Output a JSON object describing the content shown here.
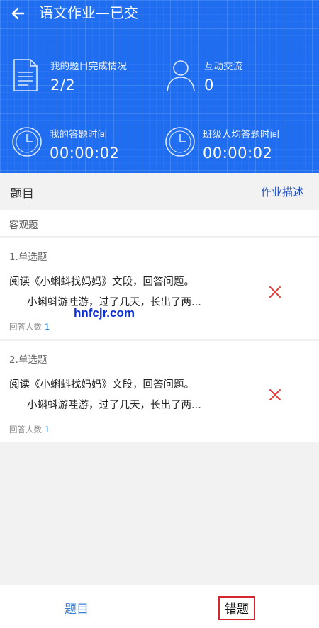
{
  "header": {
    "title": "语文作业—已交",
    "stats": {
      "completion": {
        "label": "我的题目完成情况",
        "value": "2/2"
      },
      "interaction": {
        "label": "互动交流",
        "value": "0"
      },
      "my_time": {
        "label": "我的答题时间",
        "value": "00:00:02"
      },
      "class_avg_time": {
        "label": "班级人均答题时间",
        "value": "00:00:02"
      }
    }
  },
  "section": {
    "title": "题目",
    "description_link": "作业描述"
  },
  "category": "客观题",
  "questions": [
    {
      "type": "1.单选题",
      "line1": "阅读《小蝌蚪找妈妈》文段，回答问题。",
      "line2": "小蝌蚪游哇游，过了几天，长出了两...",
      "answers_label": "回答人数",
      "answers_count": "1",
      "status_icon": "wrong-x"
    },
    {
      "type": "2.单选题",
      "line1": "阅读《小蝌蚪找妈妈》文段，回答问题。",
      "line2": "小蝌蚪游哇游，过了几天，长出了两...",
      "answers_label": "回答人数",
      "answers_count": "1",
      "status_icon": "wrong-x"
    }
  ],
  "watermark": "hnfcjr.com",
  "bottom_tabs": {
    "topic": "题目",
    "wrong": "错题"
  },
  "colors": {
    "header_bg": "#1f6df0",
    "link": "#1d4fc4",
    "wrong_mark": "#e03b3b",
    "highlight_box": "#d6262d"
  }
}
